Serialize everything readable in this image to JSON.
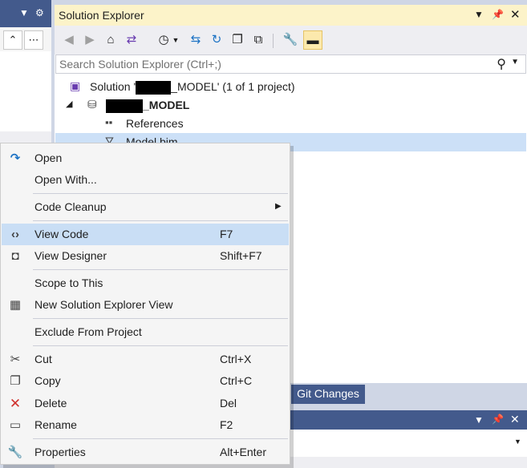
{
  "solution_explorer": {
    "title": "Solution Explorer",
    "search_placeholder": "Search Solution Explorer (Ctrl+;)",
    "tree": {
      "solution_prefix": "Solution '",
      "solution_suffix": "_MODEL' (1 of 1 project)",
      "project_suffix": "_MODEL",
      "references": "References",
      "model_file": "Model.bim"
    }
  },
  "tabs": {
    "git_changes": "Git Changes"
  },
  "context_menu": {
    "items": [
      {
        "label": "Open",
        "shortcut": "",
        "icon": "redo-arrow-icon"
      },
      {
        "label": "Open With...",
        "shortcut": ""
      },
      {
        "label": "Code Cleanup",
        "shortcut": "",
        "submenu": true
      },
      {
        "label": "View Code",
        "shortcut": "F7",
        "icon": "code-brackets-icon"
      },
      {
        "label": "View Designer",
        "shortcut": "Shift+F7",
        "icon": "designer-icon"
      },
      {
        "label": "Scope to This",
        "shortcut": ""
      },
      {
        "label": "New Solution Explorer View",
        "shortcut": "",
        "icon": "new-view-icon"
      },
      {
        "label": "Exclude From Project",
        "shortcut": ""
      },
      {
        "label": "Cut",
        "shortcut": "Ctrl+X",
        "icon": "scissors-icon"
      },
      {
        "label": "Copy",
        "shortcut": "Ctrl+C",
        "icon": "copy-icon"
      },
      {
        "label": "Delete",
        "shortcut": "Del",
        "icon": "delete-x-icon"
      },
      {
        "label": "Rename",
        "shortcut": "F2",
        "icon": "rename-icon"
      },
      {
        "label": "Properties",
        "shortcut": "Alt+Enter",
        "icon": "wrench-icon"
      }
    ]
  },
  "colors": {
    "title_active": "#fcf3c9",
    "tool_window_title": "#435a8c",
    "selection": "#cce0f7",
    "menu_highlight": "#c9def5",
    "menu_bg": "#f5f5f5"
  }
}
